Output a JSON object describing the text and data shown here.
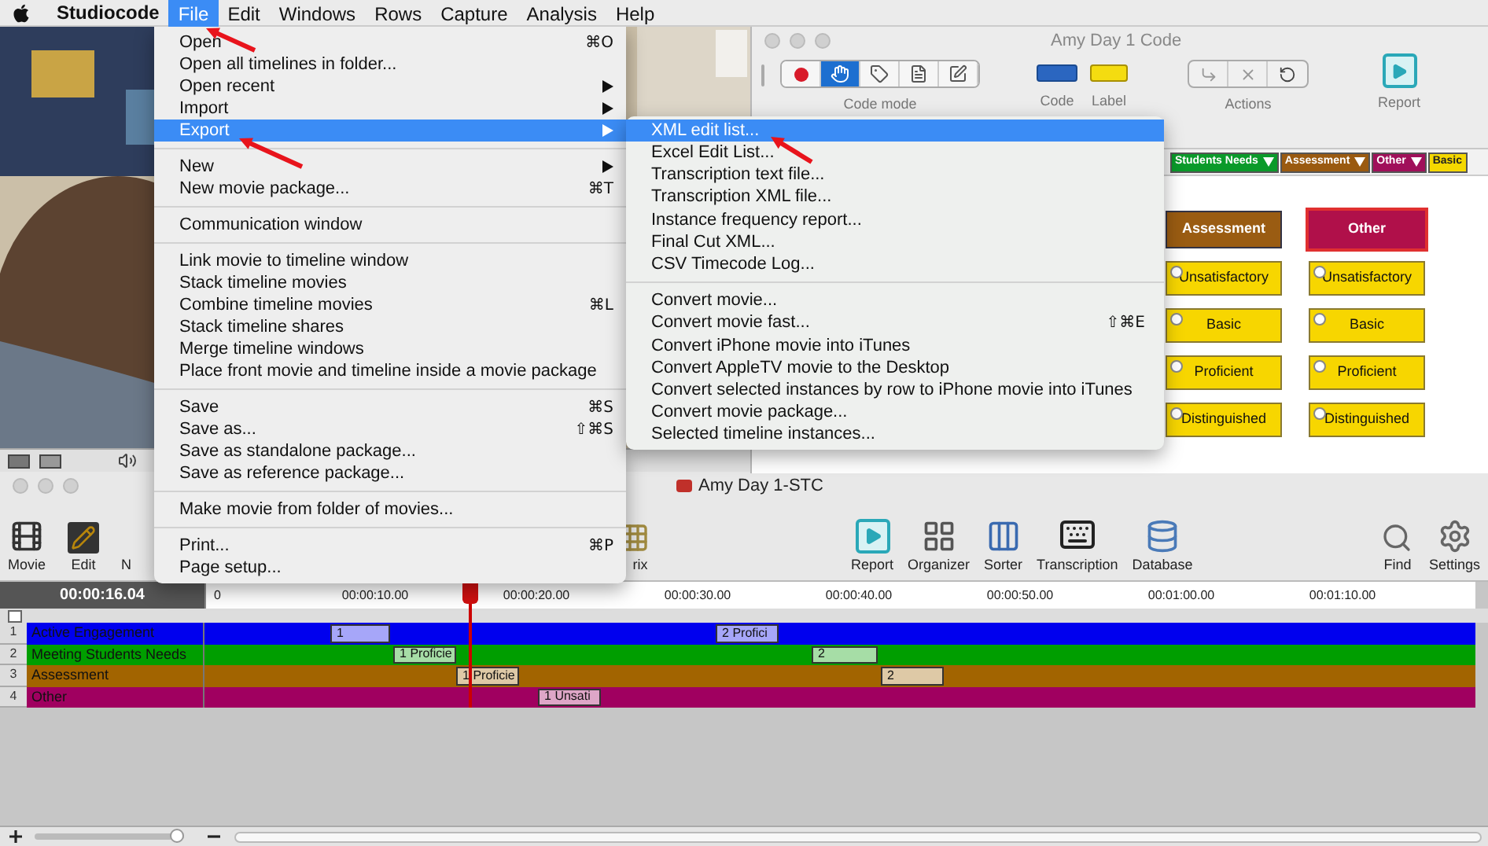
{
  "menu_bar": {
    "app_name": "Studiocode",
    "menus": [
      {
        "label": "File",
        "selected": true
      },
      {
        "label": "Edit",
        "selected": false
      },
      {
        "label": "Windows",
        "selected": false
      },
      {
        "label": "Rows",
        "selected": false
      },
      {
        "label": "Capture",
        "selected": false
      },
      {
        "label": "Analysis",
        "selected": false
      },
      {
        "label": "Help",
        "selected": false
      }
    ]
  },
  "file_menu": {
    "groups": [
      [
        {
          "label": "Open",
          "shortcut": "⌘O",
          "submenu": false,
          "selected": false
        },
        {
          "label": "Open all timelines in folder...",
          "submenu": false,
          "selected": false
        },
        {
          "label": "Open recent",
          "submenu": true,
          "selected": false
        },
        {
          "label": "Import",
          "submenu": true,
          "selected": false
        },
        {
          "label": "Export",
          "submenu": true,
          "selected": true
        }
      ],
      [
        {
          "label": "New",
          "submenu": true,
          "selected": false
        },
        {
          "label": "New movie package...",
          "shortcut": "⌘T",
          "submenu": false,
          "selected": false
        }
      ],
      [
        {
          "label": "Communication window",
          "submenu": false,
          "selected": false
        }
      ],
      [
        {
          "label": "Link movie to timeline window",
          "submenu": false,
          "selected": false
        },
        {
          "label": "Stack timeline movies",
          "submenu": false,
          "selected": false
        },
        {
          "label": "Combine timeline movies",
          "shortcut": "⌘L",
          "submenu": false,
          "selected": false
        },
        {
          "label": "Stack timeline shares",
          "submenu": false,
          "selected": false
        },
        {
          "label": "Merge timeline windows",
          "submenu": false,
          "selected": false
        },
        {
          "label": "Place front movie and timeline inside a movie package",
          "submenu": false,
          "selected": false
        }
      ],
      [
        {
          "label": "Save",
          "shortcut": "⌘S",
          "submenu": false,
          "selected": false
        },
        {
          "label": "Save as...",
          "shortcut": "⇧⌘S",
          "submenu": false,
          "selected": false
        },
        {
          "label": "Save as standalone package...",
          "submenu": false,
          "selected": false
        },
        {
          "label": "Save as reference package...",
          "submenu": false,
          "selected": false
        }
      ],
      [
        {
          "label": "Make movie from folder of movies...",
          "submenu": false,
          "selected": false
        }
      ],
      [
        {
          "label": "Print...",
          "shortcut": "⌘P",
          "submenu": false,
          "selected": false
        },
        {
          "label": "Page setup...",
          "submenu": false,
          "selected": false
        }
      ]
    ]
  },
  "export_submenu": {
    "groups": [
      [
        {
          "label": "XML edit list...",
          "selected": true
        },
        {
          "label": "Excel Edit List...",
          "selected": false
        },
        {
          "label": "Transcription text file...",
          "selected": false
        },
        {
          "label": "Transcription XML file...",
          "selected": false
        },
        {
          "label": "Instance frequency report...",
          "selected": false
        },
        {
          "label": "Final Cut XML...",
          "selected": false
        },
        {
          "label": "CSV Timecode Log...",
          "selected": false
        }
      ],
      [
        {
          "label": "Convert movie...",
          "selected": false
        },
        {
          "label": "Convert movie fast...",
          "shortcut": "⇧⌘E",
          "selected": false
        },
        {
          "label": "Convert iPhone movie into iTunes",
          "selected": false
        },
        {
          "label": "Convert AppleTV movie to the Desktop",
          "selected": false
        },
        {
          "label": "Convert selected instances by row to iPhone movie into iTunes",
          "selected": false
        },
        {
          "label": "Convert movie package...",
          "selected": false
        },
        {
          "label": "Selected timeline instances...",
          "selected": false
        }
      ]
    ]
  },
  "code_window": {
    "title": "Amy Day 1 Code",
    "mode_tools": [
      {
        "kind": "record",
        "selected": false
      },
      {
        "kind": "hand",
        "selected": true
      },
      {
        "kind": "tag",
        "selected": false
      },
      {
        "kind": "page",
        "selected": false
      },
      {
        "kind": "edit",
        "selected": false
      }
    ],
    "mode_label": "Code mode",
    "code_label": "Code",
    "label_label": "Label",
    "actions_label": "Actions",
    "report_label": "Report",
    "row_tabs": [
      {
        "label": "Students Needs",
        "color": "#0a9a2a",
        "kind": "row"
      },
      {
        "label": "Assessment",
        "color": "#9a5a10",
        "kind": "row"
      },
      {
        "label": "Other",
        "color": "#a0105a",
        "kind": "row"
      },
      {
        "label": "Basic",
        "color": "#f5d800",
        "kind": "label"
      }
    ],
    "columns": [
      {
        "header": "Assessment",
        "color": "#9a5c12",
        "selected": false,
        "buttons": [
          "Unsatisfactory",
          "Basic",
          "Proficient",
          "Distinguished"
        ]
      },
      {
        "header": "Other",
        "color": "#b0104a",
        "selected": true,
        "buttons": [
          "Unsatisfactory",
          "Basic",
          "Proficient",
          "Distinguished"
        ]
      }
    ]
  },
  "timeline_window": {
    "title": "Amy Day 1-STC",
    "tools_left": [
      {
        "label": "Movie",
        "kind": "movie"
      },
      {
        "label": "Edit",
        "kind": "edit"
      },
      {
        "label": "N",
        "kind": "hidden"
      }
    ],
    "tools_middle": [
      {
        "label": "rix",
        "kind": "matrix"
      }
    ],
    "tools_right": [
      {
        "label": "Report",
        "kind": "report"
      },
      {
        "label": "Organizer",
        "kind": "organizer"
      },
      {
        "label": "Sorter",
        "kind": "sorter"
      },
      {
        "label": "Transcription",
        "kind": "transcription"
      },
      {
        "label": "Database",
        "kind": "database"
      }
    ],
    "tools_far": [
      {
        "label": "Find",
        "kind": "find"
      },
      {
        "label": "Settings",
        "kind": "settings"
      }
    ],
    "timecode": "00:00:16.04",
    "header_checkbox": {
      "checked": false
    },
    "ruler": [
      "0",
      "00:00:10.00",
      "00:00:20.00",
      "00:00:30.00",
      "00:00:40.00",
      "00:00:50.00",
      "00:01:00.00",
      "00:01:10.00"
    ],
    "rows": [
      {
        "number": "1",
        "label": "Active Engagement",
        "color": "#0000ee",
        "instances": [
          {
            "number": "1"
          },
          {
            "number": "2",
            "text": "Profici"
          }
        ]
      },
      {
        "number": "2",
        "label": "Meeting Students Needs",
        "color": "#009e00",
        "instances": [
          {
            "number": "1",
            "text": "Proficie"
          },
          {
            "number": "2"
          }
        ]
      },
      {
        "number": "3",
        "label": "Assessment",
        "color": "#a26400",
        "instances": [
          {
            "number": "1",
            "text": "Proficie"
          },
          {
            "number": "2"
          }
        ]
      },
      {
        "number": "4",
        "label": "Other",
        "color": "#a00060",
        "instances": [
          {
            "number": "1",
            "text": "Unsati"
          }
        ]
      }
    ],
    "zoom_slider": {
      "level": 0.95
    }
  }
}
